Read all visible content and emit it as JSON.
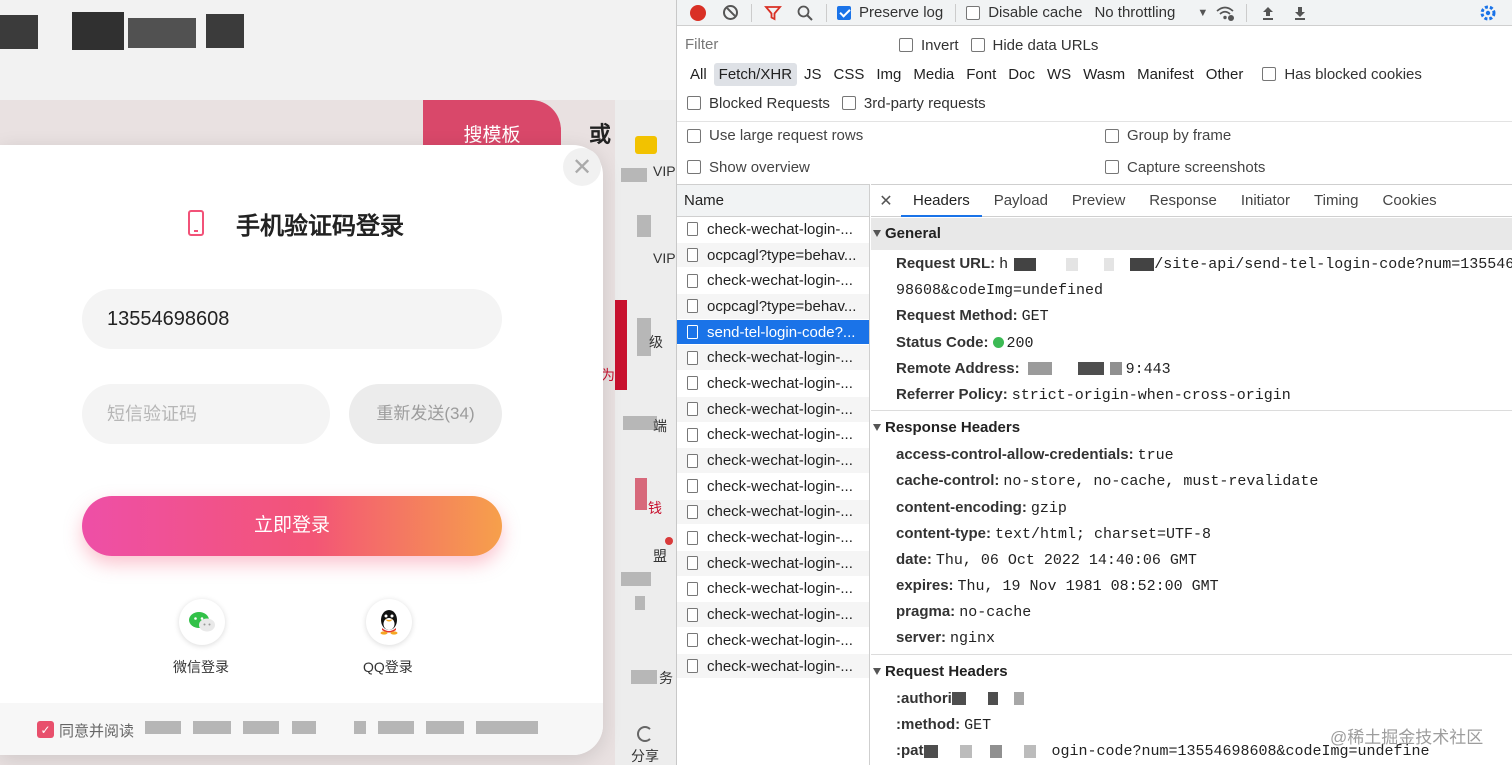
{
  "webpage": {
    "search_button_label": "搜模板",
    "or_text": "或",
    "strip_labels": [
      "VIP",
      "VIP",
      "级",
      "为",
      "端",
      "钱",
      "盟",
      "务",
      "分享"
    ],
    "modal": {
      "title": "手机验证码登录",
      "phone_value": "13554698608",
      "sms_placeholder": "短信验证码",
      "resend_label": "重新发送(34)",
      "login_label": "立即登录",
      "wechat_label": "微信登录",
      "qq_label": "QQ登录",
      "agree_text": "同意并阅读",
      "agree_checked": true
    },
    "colors": {
      "accent": "#f35576",
      "gradient_start": "#ee4fa7",
      "gradient_end": "#f6a04b"
    }
  },
  "devtools": {
    "toolbar": {
      "preserve_log": "Preserve log",
      "preserve_log_checked": true,
      "disable_cache": "Disable cache",
      "disable_cache_checked": false,
      "throttling": "No throttling"
    },
    "filter": {
      "placeholder": "Filter",
      "invert": "Invert",
      "hide_data_urls": "Hide data URLs"
    },
    "type_filters": [
      "All",
      "Fetch/XHR",
      "JS",
      "CSS",
      "Img",
      "Media",
      "Font",
      "Doc",
      "WS",
      "Wasm",
      "Manifest",
      "Other"
    ],
    "active_type_filter": "Fetch/XHR",
    "has_blocked_cookies": "Has blocked cookies",
    "blocked_requests": "Blocked Requests",
    "third_party": "3rd-party requests",
    "options": {
      "large_rows": "Use large request rows",
      "group_by_frame": "Group by frame",
      "show_overview": "Show overview",
      "capture_screenshots": "Capture screenshots"
    },
    "request_list": {
      "header": "Name",
      "items": [
        "check-wechat-login-...",
        "ocpcagl?type=behav...",
        "check-wechat-login-...",
        "ocpcagl?type=behav...",
        "send-tel-login-code?...",
        "check-wechat-login-...",
        "check-wechat-login-...",
        "check-wechat-login-...",
        "check-wechat-login-...",
        "check-wechat-login-...",
        "check-wechat-login-...",
        "check-wechat-login-...",
        "check-wechat-login-...",
        "check-wechat-login-...",
        "check-wechat-login-...",
        "check-wechat-login-...",
        "check-wechat-login-...",
        "check-wechat-login-..."
      ],
      "selected_index": 4
    },
    "detail_tabs": [
      "Headers",
      "Payload",
      "Preview",
      "Response",
      "Initiator",
      "Timing",
      "Cookies"
    ],
    "active_detail_tab": "Headers",
    "general": {
      "title": "General",
      "request_url_label": "Request URL:",
      "request_url_prefix": "h",
      "request_url_rest": "/site-api/send-tel-login-code?num=135546",
      "request_url_cont": "98608&codeImg=undefined",
      "request_method_label": "Request Method:",
      "request_method": "GET",
      "status_code_label": "Status Code:",
      "status_code": "200",
      "remote_address_label": "Remote Address:",
      "remote_address_tail": "9:443",
      "referrer_policy_label": "Referrer Policy:",
      "referrer_policy": "strict-origin-when-cross-origin"
    },
    "response_headers": {
      "title": "Response Headers",
      "items": [
        {
          "k": "access-control-allow-credentials:",
          "v": "true"
        },
        {
          "k": "cache-control:",
          "v": "no-store, no-cache, must-revalidate"
        },
        {
          "k": "content-encoding:",
          "v": "gzip"
        },
        {
          "k": "content-type:",
          "v": "text/html; charset=UTF-8"
        },
        {
          "k": "date:",
          "v": "Thu, 06 Oct 2022 14:40:06 GMT"
        },
        {
          "k": "expires:",
          "v": "Thu, 19 Nov 1981 08:52:00 GMT"
        },
        {
          "k": "pragma:",
          "v": "no-cache"
        },
        {
          "k": "server:",
          "v": "nginx"
        }
      ]
    },
    "request_headers": {
      "title": "Request Headers",
      "authority_label": ":authori",
      "method_label": ":method:",
      "method_value": "GET",
      "path_label": ":pat",
      "path_value": "ogin-code?num=13554698608&codeImg=undefine"
    },
    "colors": {
      "accent": "#1a73e8",
      "status_ok": "#3cba54",
      "record": "#d93025"
    }
  },
  "watermark": "@稀土掘金技术社区"
}
